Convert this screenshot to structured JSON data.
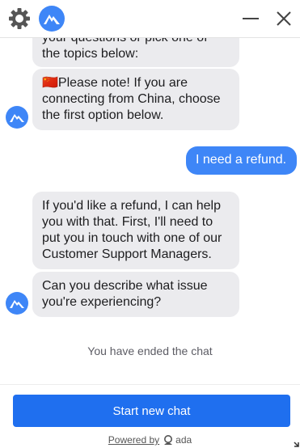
{
  "header": {
    "settings_icon": "gear-icon",
    "logo_icon": "brand-logo-icon",
    "minimize_icon": "minimize-icon",
    "close_icon": "close-icon"
  },
  "messages": {
    "bot1_line1": "your questions or pick one of",
    "bot1_line2": "the topics below:",
    "bot2_flag": "🇨🇳",
    "bot2_line1": "Please note! If you are",
    "bot2_line2": "connecting from China, choose",
    "bot2_line3": "the first option below.",
    "user1": "I need a refund.",
    "bot3_line1": "If you'd like a refund, I can help",
    "bot3_line2": "you with that. First, I'll need to",
    "bot3_line3": "put you in touch with one of our",
    "bot3_line4": "Customer Support Managers.",
    "bot4_line1": "Can you describe what issue",
    "bot4_line2": "you're experiencing?"
  },
  "status": {
    "ended": "You have ended the chat"
  },
  "footer": {
    "start_label": "Start new chat",
    "powered_by": "Powered by",
    "brand": "ada"
  },
  "colors": {
    "accent": "#1f6fef",
    "user_bubble": "#3e86f7",
    "bot_bubble": "#ebebee"
  }
}
